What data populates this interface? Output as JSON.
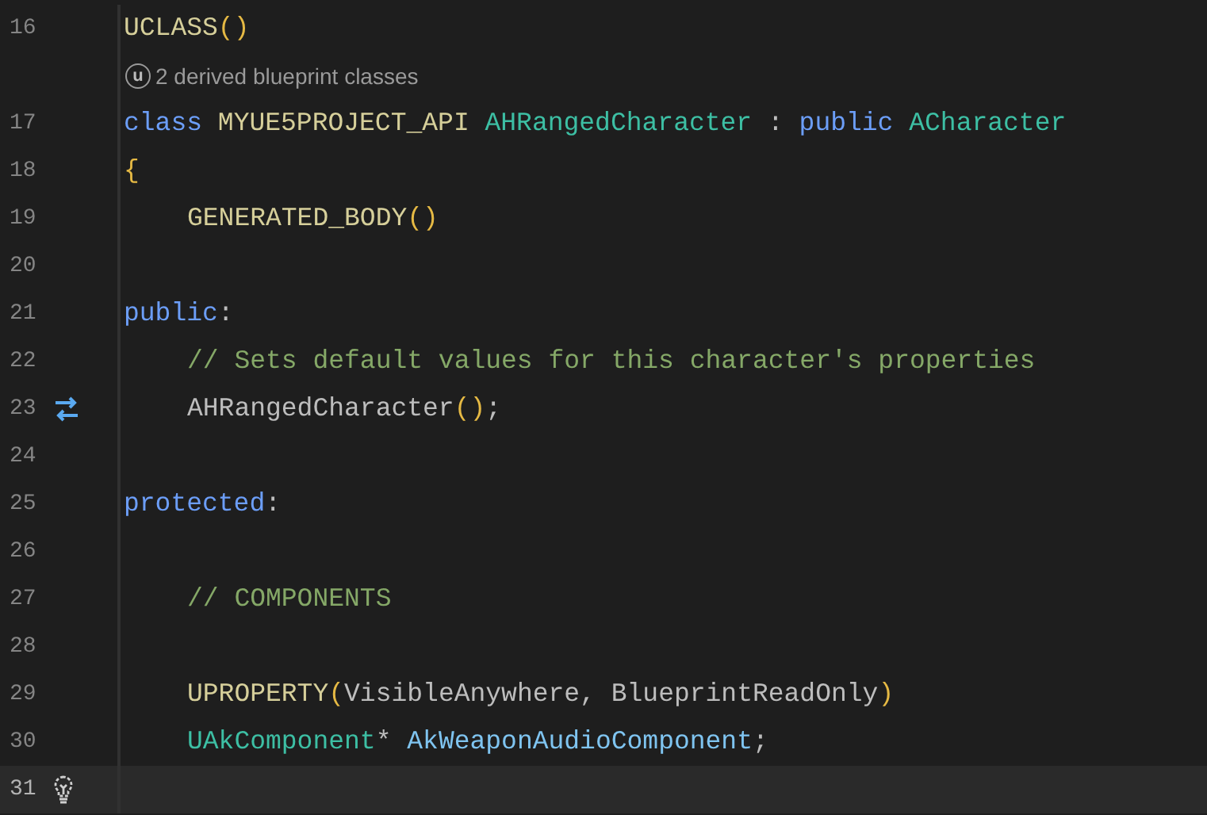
{
  "editor": {
    "lines": [
      {
        "kind": "code",
        "number": "16",
        "indented": false,
        "current": false,
        "tokens": [
          {
            "text": "UCLASS",
            "kind": "macro"
          },
          {
            "text": "()",
            "kind": "paren"
          }
        ]
      },
      {
        "kind": "hint",
        "badge": "u",
        "text": "2 derived blueprint classes"
      },
      {
        "kind": "code",
        "number": "17",
        "indented": false,
        "current": false,
        "tokens": [
          {
            "text": "class",
            "kind": "keyword"
          },
          {
            "text": " MYUE5PROJECT_API",
            "kind": "macro"
          },
          {
            "text": " AHRangedCharacter",
            "kind": "type"
          },
          {
            "text": " : ",
            "kind": "plain"
          },
          {
            "text": "public",
            "kind": "keyword"
          },
          {
            "text": " ACharacter",
            "kind": "type"
          }
        ]
      },
      {
        "kind": "code",
        "number": "18",
        "indented": false,
        "current": false,
        "tokens": [
          {
            "text": "{",
            "kind": "paren"
          }
        ]
      },
      {
        "kind": "code",
        "number": "19",
        "indented": true,
        "current": false,
        "tokens": [
          {
            "text": "GENERATED_BODY",
            "kind": "macro"
          },
          {
            "text": "()",
            "kind": "paren"
          }
        ]
      },
      {
        "kind": "code",
        "number": "20",
        "current": false
      },
      {
        "kind": "code",
        "number": "21",
        "indented": false,
        "current": false,
        "tokens": [
          {
            "text": "public",
            "kind": "keyword"
          },
          {
            "text": ":",
            "kind": "plain"
          }
        ]
      },
      {
        "kind": "code",
        "number": "22",
        "indented": true,
        "current": false,
        "tokens": [
          {
            "text": "// Sets default values for this character's properties",
            "kind": "comment"
          }
        ]
      },
      {
        "kind": "code",
        "number": "23",
        "indented": true,
        "current": false,
        "gutter": {
          "kind": "swap"
        },
        "tokens": [
          {
            "text": "AHRangedCharacter",
            "kind": "plain"
          },
          {
            "text": "()",
            "kind": "paren"
          },
          {
            "text": ";",
            "kind": "plain"
          }
        ]
      },
      {
        "kind": "code",
        "number": "24",
        "current": false
      },
      {
        "kind": "code",
        "number": "25",
        "indented": false,
        "current": false,
        "tokens": [
          {
            "text": "protected",
            "kind": "keyword"
          },
          {
            "text": ":",
            "kind": "plain"
          }
        ]
      },
      {
        "kind": "code",
        "number": "26",
        "current": false
      },
      {
        "kind": "code",
        "number": "27",
        "indented": true,
        "current": false,
        "tokens": [
          {
            "text": "// COMPONENTS",
            "kind": "comment"
          }
        ]
      },
      {
        "kind": "code",
        "number": "28",
        "current": false
      },
      {
        "kind": "code",
        "number": "29",
        "indented": true,
        "current": false,
        "tokens": [
          {
            "text": "UPROPERTY",
            "kind": "macro"
          },
          {
            "text": "(",
            "kind": "paren"
          },
          {
            "text": "VisibleAnywhere, BlueprintReadOnly",
            "kind": "plain"
          },
          {
            "text": ")",
            "kind": "paren"
          }
        ]
      },
      {
        "kind": "code",
        "number": "30",
        "indented": true,
        "current": false,
        "tokens": [
          {
            "text": "UAkComponent",
            "kind": "type"
          },
          {
            "text": "* ",
            "kind": "plain"
          },
          {
            "text": "AkWeaponAudioComponent",
            "kind": "field"
          },
          {
            "text": ";",
            "kind": "plain"
          }
        ]
      },
      {
        "kind": "code",
        "number": "31",
        "current": true,
        "gutter": {
          "kind": "bulb"
        }
      }
    ]
  }
}
